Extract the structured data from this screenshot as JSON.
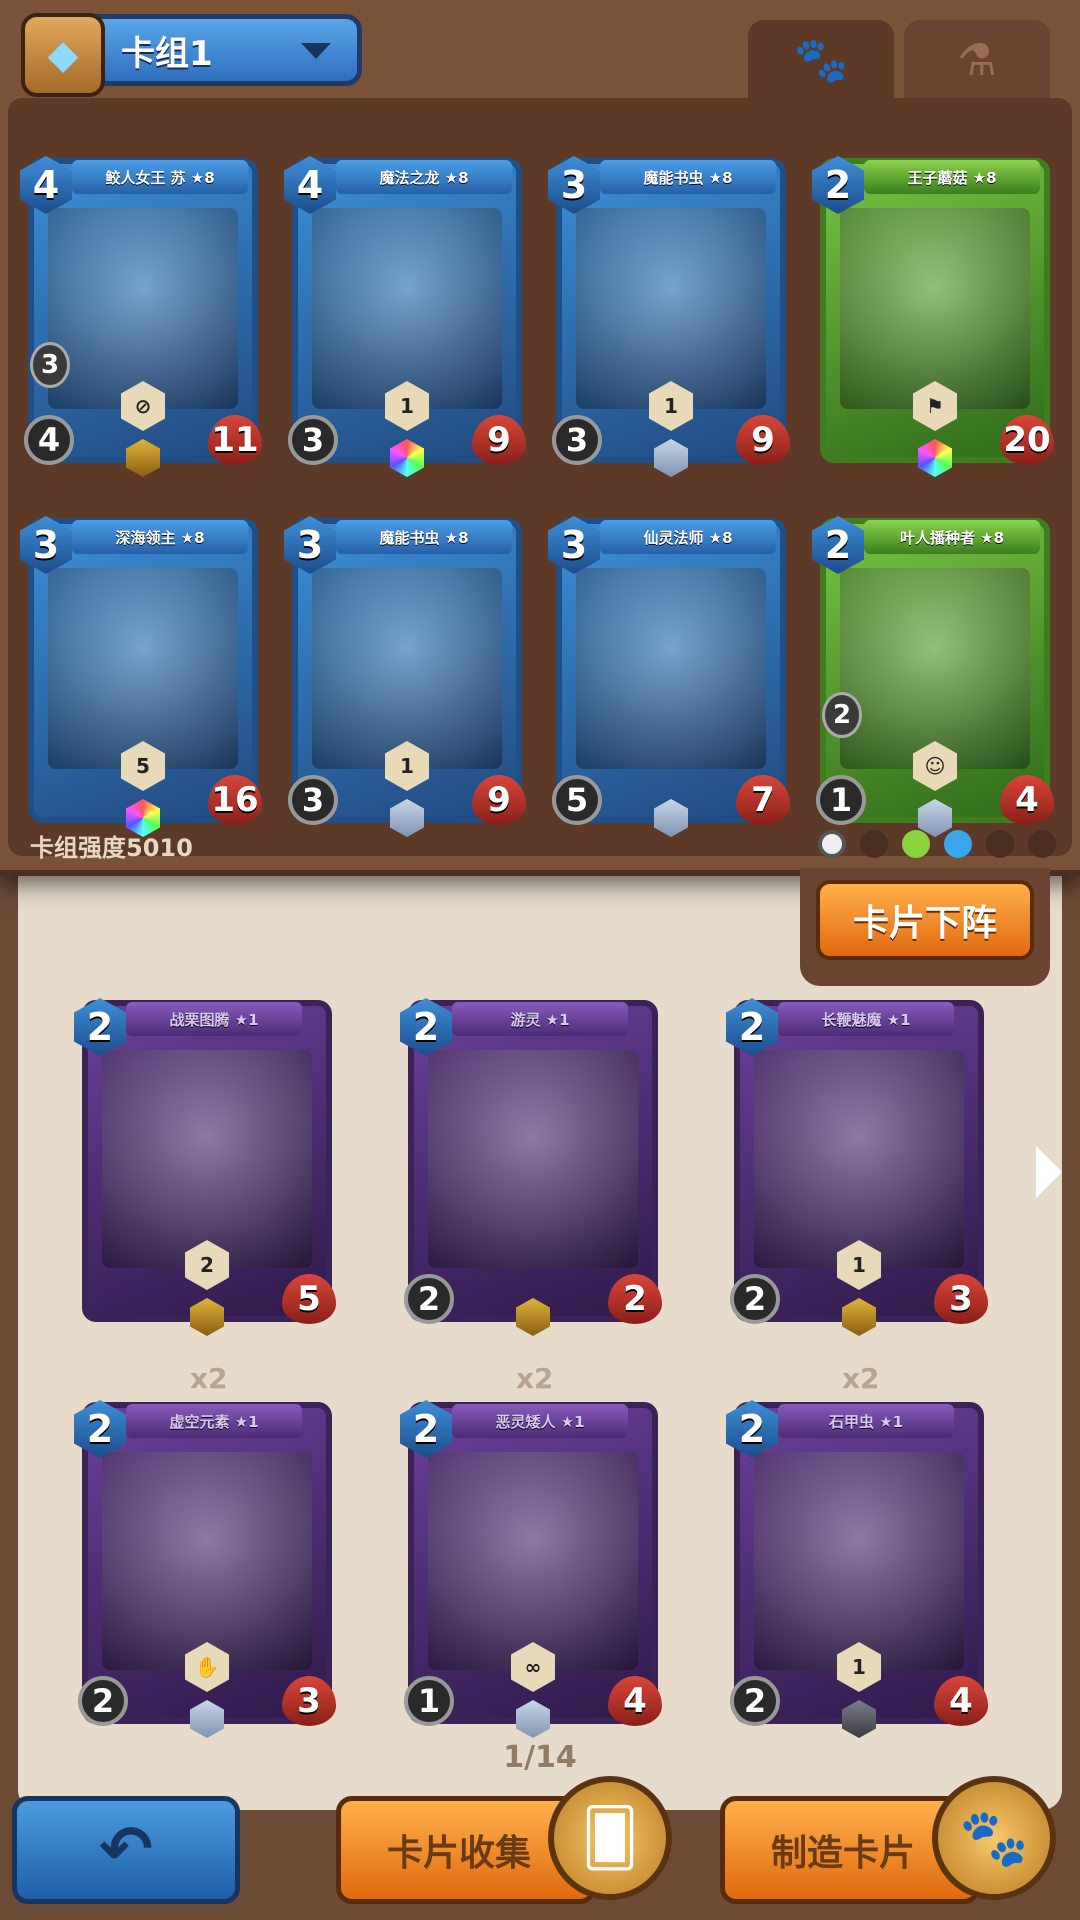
{
  "deck": {
    "title": "卡组1",
    "strength": "卡组强度5010",
    "cards": [
      {
        "name": "鲛人女王 苏 ★8",
        "cost": "4",
        "attack": "4",
        "health": "11",
        "color": "blue",
        "ability": "⊘",
        "gem": "gold",
        "side": "3"
      },
      {
        "name": "魔法之龙 ★8",
        "cost": "4",
        "attack": "3",
        "health": "9",
        "color": "blue",
        "ability": "1",
        "gem": "rainbow",
        "side": ""
      },
      {
        "name": "魔能书虫 ★8",
        "cost": "3",
        "attack": "3",
        "health": "9",
        "color": "blue",
        "ability": "1",
        "gem": "silver",
        "side": ""
      },
      {
        "name": "王子蘑菇 ★8",
        "cost": "2",
        "attack": "",
        "health": "20",
        "color": "green",
        "ability": "⚑",
        "gem": "rainbow",
        "side": ""
      },
      {
        "name": "深海领主 ★8",
        "cost": "3",
        "attack": "",
        "health": "16",
        "color": "blue",
        "ability": "5",
        "gem": "rainbow",
        "side": ""
      },
      {
        "name": "魔能书虫 ★8",
        "cost": "3",
        "attack": "3",
        "health": "9",
        "color": "blue",
        "ability": "1",
        "gem": "silver",
        "side": ""
      },
      {
        "name": "仙灵法师 ★8",
        "cost": "3",
        "attack": "5",
        "health": "7",
        "color": "blue",
        "ability": "",
        "gem": "silver",
        "side": ""
      },
      {
        "name": "叶人播种者 ★8",
        "cost": "2",
        "attack": "1",
        "health": "4",
        "color": "green",
        "ability": "☺",
        "gem": "silver",
        "side": "2"
      }
    ]
  },
  "tabs": {
    "active_icon": "paw-icon",
    "inactive_icon": "potion-icon"
  },
  "remove_button": "卡片下阵",
  "collection": {
    "page": "1/14",
    "cards": [
      {
        "name": "战栗图腾 ★1",
        "cost": "2",
        "attack": "",
        "health": "5",
        "ability": "2",
        "gem": "gold"
      },
      {
        "name": "游灵 ★1",
        "cost": "2",
        "attack": "2",
        "health": "2",
        "ability": "",
        "gem": "gold"
      },
      {
        "name": "长鞭魅魔 ★1",
        "cost": "2",
        "attack": "2",
        "health": "3",
        "ability": "1",
        "gem": "gold"
      },
      {
        "name": "虚空元素 ★1",
        "cost": "2",
        "attack": "2",
        "health": "3",
        "ability": "✋",
        "gem": "silver"
      },
      {
        "name": "恶灵矮人 ★1",
        "cost": "2",
        "attack": "1",
        "health": "4",
        "ability": "∞",
        "gem": "silver"
      },
      {
        "name": "石甲虫 ★1",
        "cost": "2",
        "attack": "2",
        "health": "4",
        "ability": "1",
        "gem": "dark"
      }
    ],
    "counts": [
      "x2",
      "x2",
      "x2"
    ]
  },
  "bottom": {
    "back_label": "↶",
    "collect_label": "卡片收集",
    "craft_label": "制造卡片"
  }
}
